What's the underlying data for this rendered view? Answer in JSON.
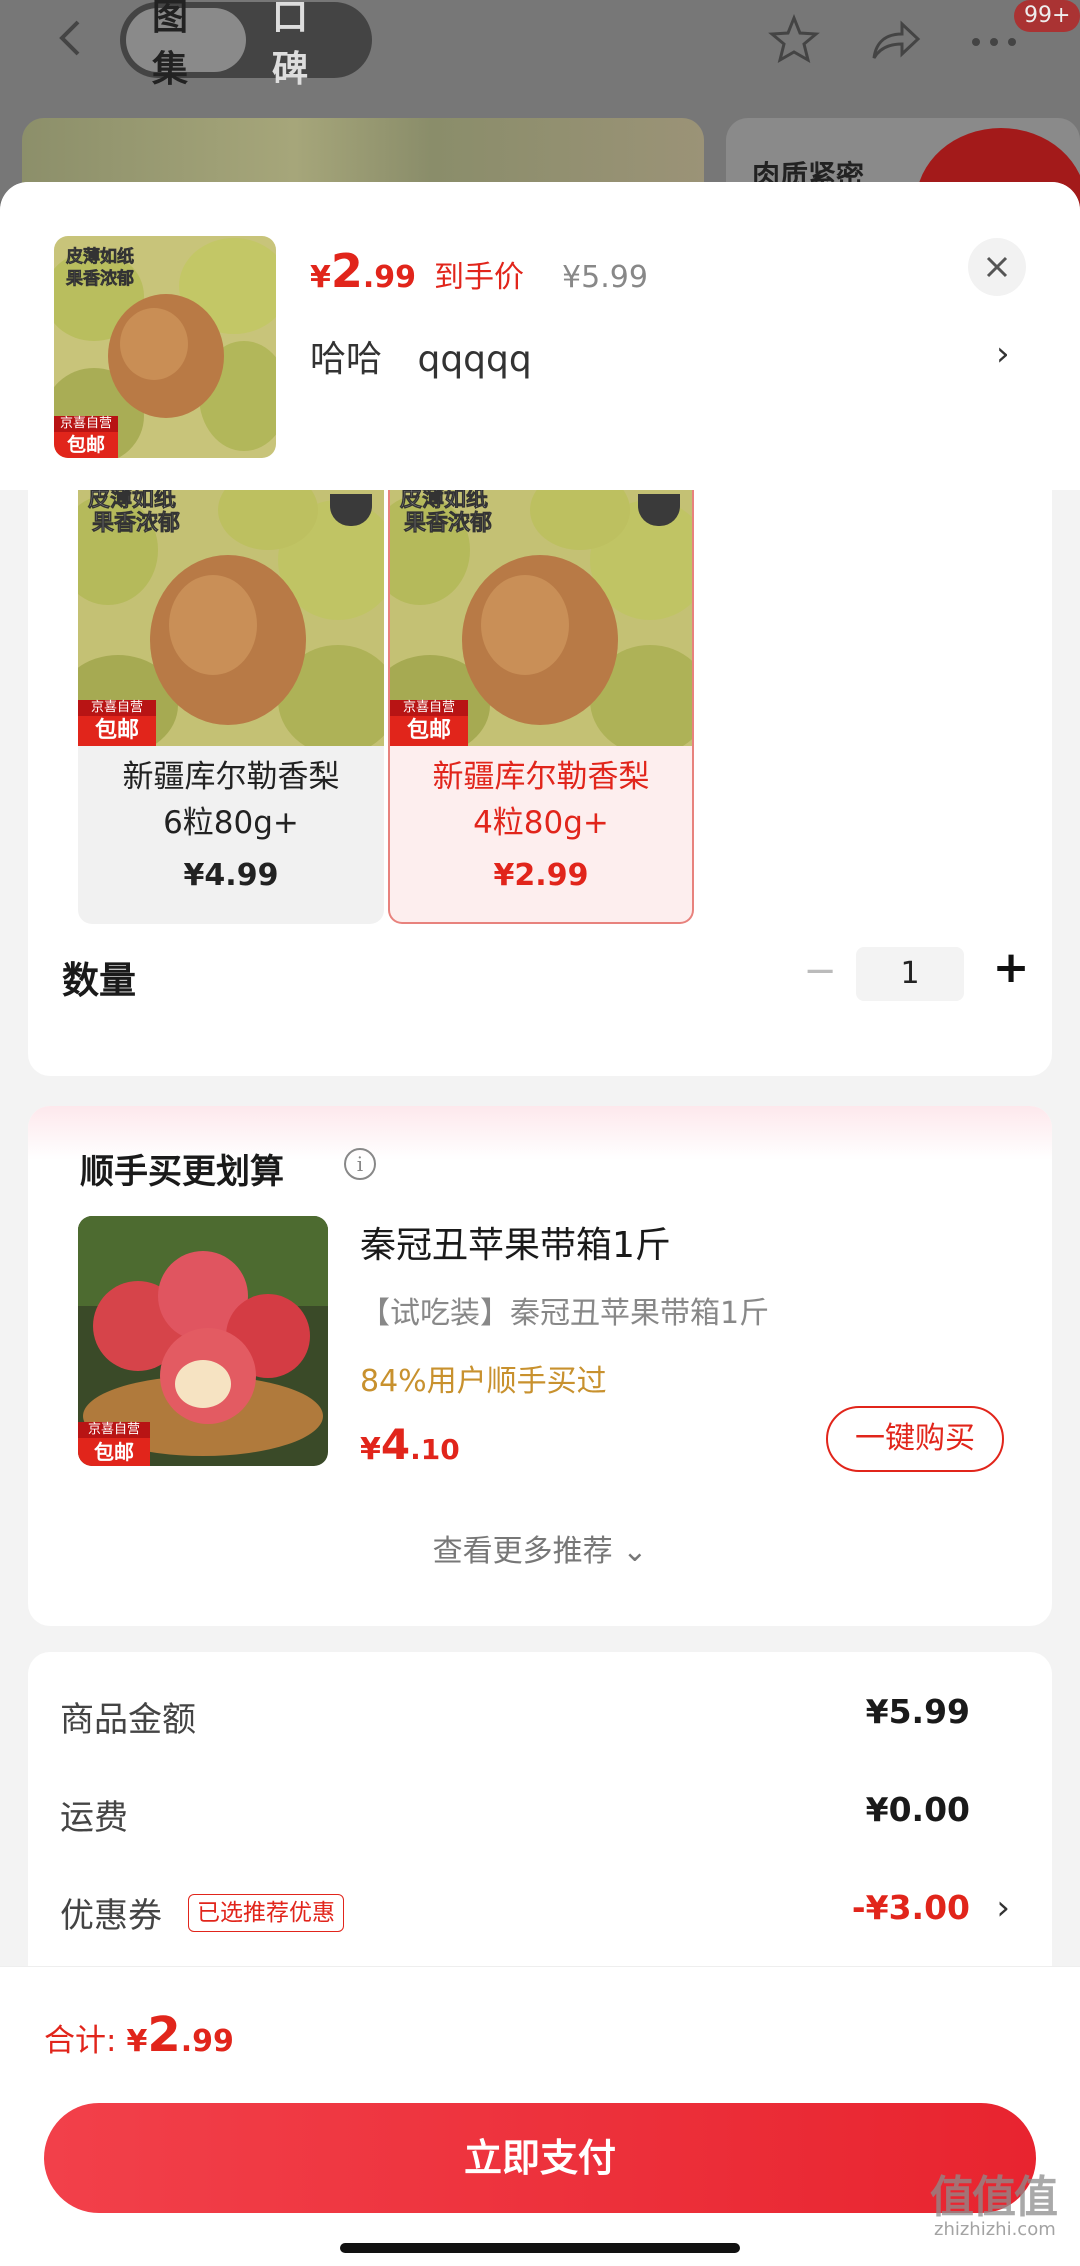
{
  "background": {
    "tabs": [
      "图集",
      "口碑"
    ],
    "badge": "99+",
    "card_text": "肉质紧密"
  },
  "header": {
    "price_currency": "¥",
    "price_int": "2",
    "price_dec": ".99",
    "price_tag": "到手价",
    "original_price": "¥5.99",
    "selection": [
      "哈哈",
      "qqqqq"
    ]
  },
  "product_badge": {
    "image_text_line1": "皮薄如纸",
    "image_text_line2": "果香浓郁",
    "store_tag": "京喜自营",
    "shipping_tag": "包邮"
  },
  "variants": [
    {
      "name_line1": "新疆库尔勒香梨",
      "name_line2": "6粒80g+",
      "price": "¥4.99",
      "selected": false
    },
    {
      "name_line1": "新疆库尔勒香梨",
      "name_line2": "4粒80g+",
      "price": "¥2.99",
      "selected": true
    }
  ],
  "quantity": {
    "label": "数量",
    "value": "1",
    "minus": "−",
    "plus": "+"
  },
  "recommend": {
    "title": "顺手买更划算",
    "item_name": "秦冠丑苹果带箱1斤",
    "item_sub": "【试吃装】秦冠丑苹果带箱1斤",
    "item_stat": "84%用户顺手买过",
    "price_currency": "¥",
    "price_int": "4",
    "price_dec": ".10",
    "buy_label": "一键购买",
    "more_label": "查看更多推荐 ⌄"
  },
  "summary": {
    "rows": [
      {
        "label": "商品金额",
        "value": "¥5.99"
      },
      {
        "label": "运费",
        "value": "¥0.00"
      },
      {
        "label": "优惠券",
        "value": "-¥3.00",
        "tag": "已选推荐优惠"
      }
    ]
  },
  "footer": {
    "total_label": "合计:",
    "total_currency": "¥",
    "total_int": "2",
    "total_dec": ".99",
    "pay_label": "立即支付",
    "watermark": "值值值",
    "watermark_sub": "zhizhizhi.com"
  },
  "colors": {
    "accent": "#e1251b",
    "gold": "#c8912e"
  }
}
